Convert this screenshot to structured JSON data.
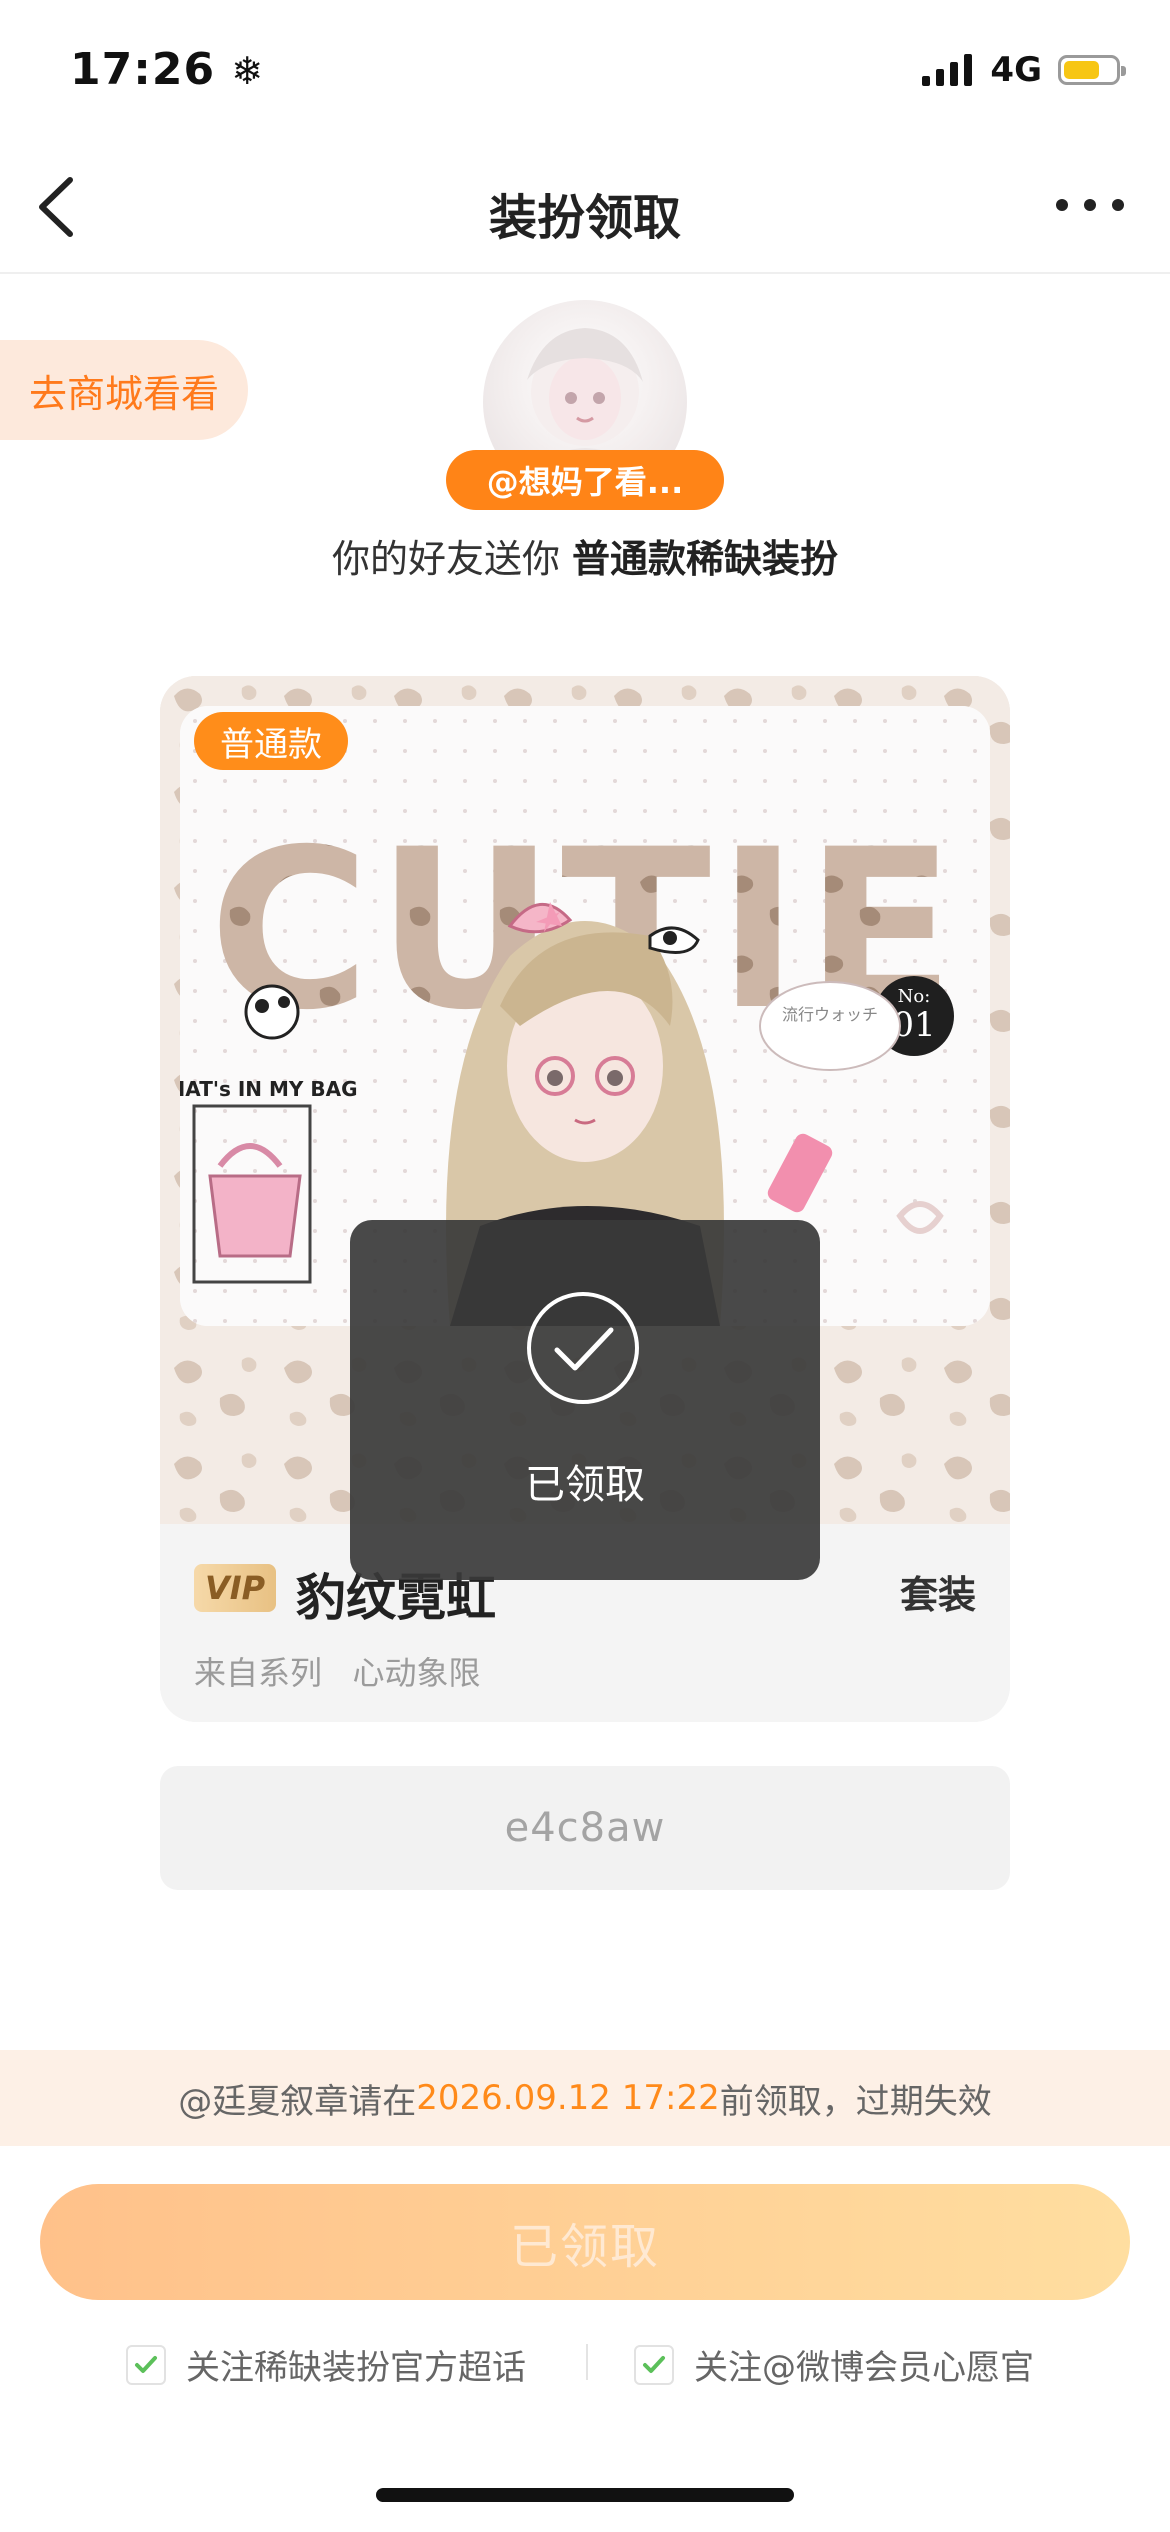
{
  "status": {
    "time": "17:26",
    "network": "4G"
  },
  "nav": {
    "title": "装扮领取"
  },
  "header": {
    "shop_button": "去商城看看",
    "username": "@想妈了看...",
    "gift_prefix": "你的好友送你",
    "gift_item": "普通款稀缺装扮"
  },
  "card": {
    "tier": "普通款",
    "vip_label": "VIP",
    "name": "豹纹霓虹",
    "series_label": "来自系列   心动象限",
    "suit_label": "套装",
    "art_text": {
      "headline": "CUTIE",
      "bag": "WHAT's IN MY BAG",
      "number_label": "No:",
      "number": "01",
      "watch": "流行ウォッチ"
    }
  },
  "toast": {
    "text": "已领取"
  },
  "code": {
    "value": "e4c8aw"
  },
  "deadline": {
    "prefix": "@廷夏叙章请在",
    "date": "2026.09.12 17:22",
    "suffix": "前领取，过期失效"
  },
  "main_button": {
    "label": "已领取"
  },
  "checks": [
    {
      "label": "关注稀缺装扮官方超话",
      "checked": true
    },
    {
      "label": "关注@微博会员心愿官",
      "checked": true
    }
  ],
  "colors": {
    "accent": "#ff8417",
    "check": "#5cc05a"
  }
}
